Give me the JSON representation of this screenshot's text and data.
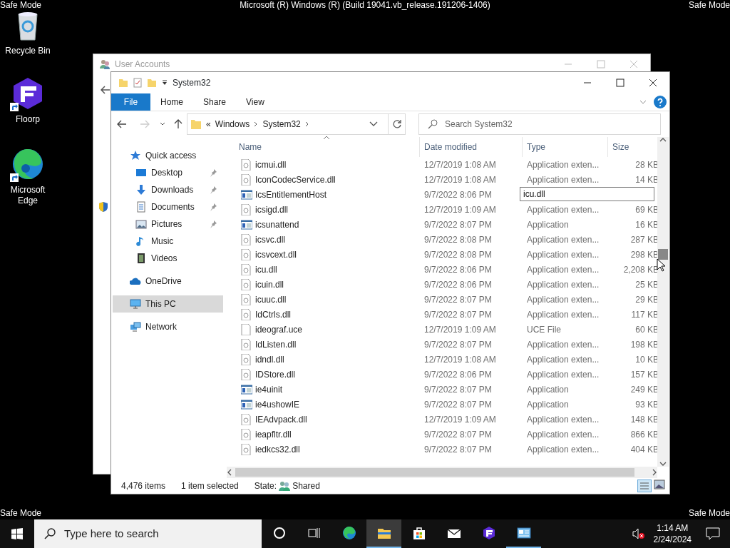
{
  "desktop": {
    "top_left": "Safe Mode",
    "top_center": "Microsoft (R) Windows (R) (Build 19041.vb_release.191206-1406)",
    "top_right": "Safe Mode",
    "bottom_left": "Safe Mode",
    "bottom_right": "Safe Mode",
    "icons": [
      {
        "label": "Recycle Bin",
        "kind": "recycle",
        "shortcut": false
      },
      {
        "label": "Floorp",
        "kind": "floorp",
        "shortcut": true
      },
      {
        "label": "Microsoft Edge",
        "kind": "edge",
        "shortcut": true
      }
    ]
  },
  "background_window": {
    "title": "User Accounts"
  },
  "explorer": {
    "title": "System32",
    "ribbon_tabs": [
      {
        "label": "File",
        "selected": true
      },
      {
        "label": "Home",
        "selected": false
      },
      {
        "label": "Share",
        "selected": false
      },
      {
        "label": "View",
        "selected": false
      }
    ],
    "address": {
      "overflow": "«",
      "crumbs": [
        "Windows",
        "System32"
      ]
    },
    "search": {
      "placeholder": "Search System32"
    },
    "nav": [
      {
        "label": "Quick access",
        "kind": "star",
        "selected": false,
        "children": [
          {
            "label": "Desktop",
            "kind": "desktop",
            "pinned": true,
            "selected": false
          },
          {
            "label": "Downloads",
            "kind": "download",
            "pinned": true,
            "selected": false
          },
          {
            "label": "Documents",
            "kind": "document",
            "pinned": true,
            "selected": false
          },
          {
            "label": "Pictures",
            "kind": "pictures",
            "pinned": true,
            "selected": false
          },
          {
            "label": "Music",
            "kind": "music",
            "pinned": false,
            "selected": false
          },
          {
            "label": "Videos",
            "kind": "videos",
            "pinned": false,
            "selected": false
          }
        ]
      },
      {
        "label": "OneDrive",
        "kind": "cloud",
        "selected": false
      },
      {
        "label": "This PC",
        "kind": "pc",
        "selected": true
      },
      {
        "label": "Network",
        "kind": "network",
        "selected": false
      }
    ],
    "columns": [
      "Name",
      "Date modified",
      "Type",
      "Size"
    ],
    "rows": [
      {
        "kind": "dll",
        "name": "icmui.dll",
        "date": "12/7/2019 1:08 AM",
        "type": "Application exten...",
        "size": "28 KB"
      },
      {
        "kind": "dll",
        "name": "IconCodecService.dll",
        "date": "12/7/2019 1:08 AM",
        "type": "Application exten...",
        "size": "14 KB"
      },
      {
        "kind": "app",
        "name": "IcsEntitlementHost",
        "date": "9/7/2022 8:06 PM",
        "rename": "icu.dll"
      },
      {
        "kind": "dll",
        "name": "icsigd.dll",
        "date": "12/7/2019 1:09 AM",
        "type": "Application exten...",
        "size": "69 KB"
      },
      {
        "kind": "app",
        "name": "icsunattend",
        "date": "9/7/2022 8:07 PM",
        "type": "Application",
        "size": "16 KB"
      },
      {
        "kind": "dll",
        "name": "icsvc.dll",
        "date": "9/7/2022 8:08 PM",
        "type": "Application exten...",
        "size": "287 KB"
      },
      {
        "kind": "dll",
        "name": "icsvcext.dll",
        "date": "9/7/2022 8:08 PM",
        "type": "Application exten...",
        "size": "298 KB"
      },
      {
        "kind": "dll",
        "name": "icu.dll",
        "date": "9/7/2022 8:06 PM",
        "type": "Application exten...",
        "size": "2,208 KB"
      },
      {
        "kind": "dll",
        "name": "icuin.dll",
        "date": "9/7/2022 8:06 PM",
        "type": "Application exten...",
        "size": "25 KB"
      },
      {
        "kind": "dll",
        "name": "icuuc.dll",
        "date": "9/7/2022 8:07 PM",
        "type": "Application exten...",
        "size": "29 KB"
      },
      {
        "kind": "dll",
        "name": "IdCtrls.dll",
        "date": "9/7/2022 8:07 PM",
        "type": "Application exten...",
        "size": "117 KB"
      },
      {
        "kind": "file",
        "name": "ideograf.uce",
        "date": "12/7/2019 1:09 AM",
        "type": "UCE File",
        "size": "60 KB"
      },
      {
        "kind": "dll",
        "name": "IdListen.dll",
        "date": "9/7/2022 8:07 PM",
        "type": "Application exten...",
        "size": "198 KB"
      },
      {
        "kind": "dll",
        "name": "idndl.dll",
        "date": "12/7/2019 1:08 AM",
        "type": "Application exten...",
        "size": "10 KB"
      },
      {
        "kind": "dll",
        "name": "IDStore.dll",
        "date": "9/7/2022 8:06 PM",
        "type": "Application exten...",
        "size": "157 KB"
      },
      {
        "kind": "app",
        "name": "ie4uinit",
        "date": "9/7/2022 8:07 PM",
        "type": "Application",
        "size": "249 KB"
      },
      {
        "kind": "app",
        "name": "ie4ushowIE",
        "date": "9/7/2022 8:07 PM",
        "type": "Application",
        "size": "93 KB"
      },
      {
        "kind": "dll",
        "name": "IEAdvpack.dll",
        "date": "12/7/2019 1:09 AM",
        "type": "Application exten...",
        "size": "148 KB"
      },
      {
        "kind": "dll",
        "name": "ieapfltr.dll",
        "date": "9/7/2022 8:07 PM",
        "type": "Application exten...",
        "size": "866 KB"
      },
      {
        "kind": "dll",
        "name": "iedkcs32.dll",
        "date": "9/7/2022 8:07 PM",
        "type": "Application exten...",
        "size": "404 KB"
      }
    ],
    "status": {
      "items": "4,476 items",
      "selected": "1 item selected",
      "state_label": "State:",
      "state_value": "Shared"
    }
  },
  "taskbar": {
    "search_placeholder": "Type here to search",
    "apps": [
      {
        "kind": "cortana",
        "running": false,
        "selected": false
      },
      {
        "kind": "taskview",
        "running": false,
        "selected": false
      },
      {
        "kind": "edge",
        "running": false,
        "selected": false
      },
      {
        "kind": "explorer",
        "running": true,
        "selected": true
      },
      {
        "kind": "store",
        "running": false,
        "selected": false
      },
      {
        "kind": "mail",
        "running": false,
        "selected": false
      },
      {
        "kind": "floorp",
        "running": false,
        "selected": false
      },
      {
        "kind": "control",
        "running": true,
        "selected": false
      }
    ],
    "muted": true,
    "time": "1:14 AM",
    "date": "2/24/2024"
  }
}
